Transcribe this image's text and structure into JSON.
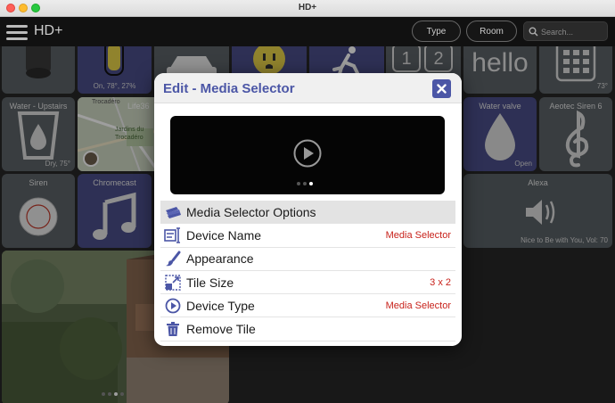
{
  "window": {
    "title": "HD+"
  },
  "toolbar": {
    "app_name": "HD+",
    "type_button": "Type",
    "room_button": "Room",
    "search_placeholder": "Search..."
  },
  "tiles": {
    "switch_status": "On, 78°, 27%",
    "hello_text": "hello",
    "keypad_temp": "73°",
    "water_upstairs": {
      "title": "Water - Upstairs",
      "status": "Dry, 75°"
    },
    "life360": {
      "title": "Life36"
    },
    "water_valve": {
      "title": "Water valve",
      "status": "Open"
    },
    "aeotec_siren": {
      "title": "Aeotec Siren 6"
    },
    "siren": {
      "title": "Siren"
    },
    "chromecast": {
      "title": "Chromecast"
    },
    "alexa": {
      "title": "Alexa",
      "status": "Nice to Be with You, Vol: 70"
    },
    "map": {
      "labels": [
        "Trocadéro",
        "Jardins du Trocadéro"
      ]
    }
  },
  "modal": {
    "title": "Edit - Media Selector",
    "options_header": "Media Selector Options",
    "rows": [
      {
        "label": "Device Name",
        "value": "Media Selector",
        "icon": "device-name-icon"
      },
      {
        "label": "Appearance",
        "value": "",
        "icon": "paintbrush-icon"
      },
      {
        "label": "Tile Size",
        "value": "3 x 2",
        "icon": "resize-icon"
      },
      {
        "label": "Device Type",
        "value": "Media Selector",
        "icon": "play-circle-icon"
      },
      {
        "label": "Remove Tile",
        "value": "",
        "icon": "trash-icon"
      }
    ]
  },
  "colors": {
    "accent": "#4b56a6",
    "value_red": "#c8221b",
    "tile_blue": "#4b4e8a",
    "tile_gray": "#5c6368"
  }
}
